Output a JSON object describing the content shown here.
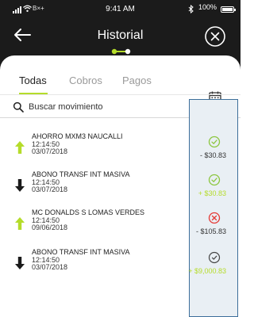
{
  "status_bar": {
    "carrier": "B×+",
    "time": "9:41 AM",
    "battery": "100%"
  },
  "header": {
    "title": "Historial"
  },
  "tabs": [
    {
      "label": "Todas",
      "active": true
    },
    {
      "label": "Cobros",
      "active": false
    },
    {
      "label": "Pagos",
      "active": false
    }
  ],
  "search": {
    "placeholder": "Buscar movimiento"
  },
  "colors": {
    "accent": "#b5dc2a",
    "header_bg": "#1b1b1b",
    "error": "#e53935",
    "credit": "#b5dc2a"
  },
  "transactions": [
    {
      "name": "AHORRO MXM3 NAUCALLI",
      "time": "12:14:50",
      "date": "03/07/2018",
      "amount": "- $30.83",
      "direction": "up",
      "status": "success-icon",
      "amount_type": "debit"
    },
    {
      "name": "ABONO TRANSF INT MASIVA",
      "time": "12:14:50",
      "date": "03/07/2018",
      "amount": "+ $30.83",
      "direction": "down",
      "status": "success-icon",
      "amount_type": "credit"
    },
    {
      "name": "MC DONALDS S LOMAS VERDES",
      "time": "12:14:50",
      "date": "09/06/2018",
      "amount": "- $105.83",
      "direction": "up",
      "status": "error-icon",
      "amount_type": "debit"
    },
    {
      "name": "ABONO TRANSF INT MASIVA",
      "time": "12:14:50",
      "date": "03/07/2018",
      "amount": "+ $9,000.83",
      "direction": "down",
      "status": "pending-icon",
      "amount_type": "credit"
    }
  ]
}
